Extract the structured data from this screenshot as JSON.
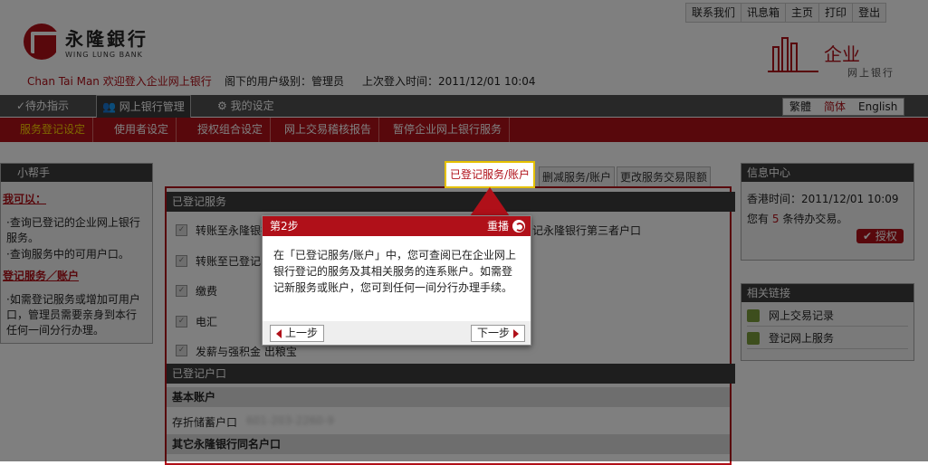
{
  "topbar": {
    "items": [
      "联系我们",
      "讯息箱",
      "主页",
      "打印",
      "登出"
    ]
  },
  "logo": {
    "cn": "永隆銀行",
    "en": "WING LUNG BANK"
  },
  "user": {
    "welcome": "Chan Tai Man 欢迎登入企业网上银行",
    "level": "阁下的用户级别：管理员",
    "last_login": "上次登入时间：2011/12/01 10:04"
  },
  "corp": {
    "title": "企业",
    "subtitle": "网上银行"
  },
  "nav": {
    "todo": "✓待办指示",
    "bank": "网上银行管理",
    "my": "我的设定"
  },
  "lang": {
    "trad": "繁體",
    "simp": "简体",
    "en": "English"
  },
  "subnav": [
    "服务登记设定",
    "使用者设定",
    "授权组合设定",
    "网上交易稽核报告",
    "暂停企业网上银行服务"
  ],
  "helper": {
    "title": "小帮手",
    "can_do": "我可以：",
    "bullets1": [
      "·查询已登记的企业网上银行服务。",
      "·查询服务中的可用户口。"
    ],
    "section2": "登记服务／账户",
    "bullets2": [
      "·如需登记服务或增加可用户口，管理员需要亲身到本行任何一间分行办理。"
    ]
  },
  "tabs": {
    "registered": "已登记服务/账户",
    "delete": "删减服务/账户",
    "limit": "更改服务交易限额"
  },
  "registered_services": {
    "header": "已登记服务",
    "items": [
      "转账至永隆银行",
      "转账至已登记",
      "缴费",
      "电汇",
      "发薪与强积金  出粮宝"
    ],
    "item_right": "记永隆银行第三者户口"
  },
  "registered_accounts": {
    "header": "已登记户口",
    "basic": "基本账户",
    "savings": "存折储蓄户口",
    "savings_masked": "601-203-2260-9",
    "others": "其它永隆银行同名户口"
  },
  "info_center": {
    "title": "信息中心",
    "time_label": "香港时间：2011/12/01 10:09",
    "pending_prefix": "您有",
    "pending_count": "5",
    "pending_suffix": "条待办交易。",
    "auth_button": "授权"
  },
  "links": {
    "title": "相关链接",
    "items": [
      "网上交易记录",
      "登记网上服务"
    ]
  },
  "tip": {
    "step": "第2步",
    "replay": "重播",
    "body": "在「已登记服务/账户」中，您可查阅已在企业网上银行登记的服务及其相关服务的连系账户。如需登记新服务或账户，您可到任何一间分行办理手续。",
    "prev": "上一步",
    "next": "下一步"
  },
  "colors": {
    "brand": "#b01019",
    "highlight": "#e5c100",
    "dark": "#3c3c3c"
  }
}
